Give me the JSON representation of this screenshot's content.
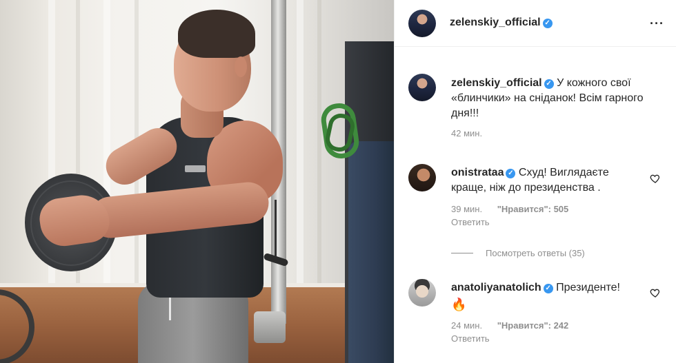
{
  "post": {
    "author": "zelenskiy_official",
    "more_icon": "more-horizontal-icon",
    "caption_text": "У кожного свої «блинчики» на сніданок! Всім гарного дня!!!",
    "caption_time": "42 мин."
  },
  "comments": [
    {
      "username": "onistrataa",
      "text": "Схуд! Виглядаєте краще, ніж до президенства .",
      "time": "39 мин.",
      "likes_label": "\"Нравится\"",
      "likes_count": ": 505",
      "reply_label": "Ответить"
    },
    {
      "username": "anatoliyanatolich",
      "text": "Президенте!",
      "emoji": "🔥",
      "time": "24 мин.",
      "likes_label": "\"Нравится\"",
      "likes_count": ": 242",
      "reply_label": "Ответить"
    }
  ],
  "view_replies": "Посмотреть ответы (35)",
  "colors": {
    "verified": "#3897f0",
    "muted_text": "#8e8e8e",
    "primary_text": "#262626"
  }
}
